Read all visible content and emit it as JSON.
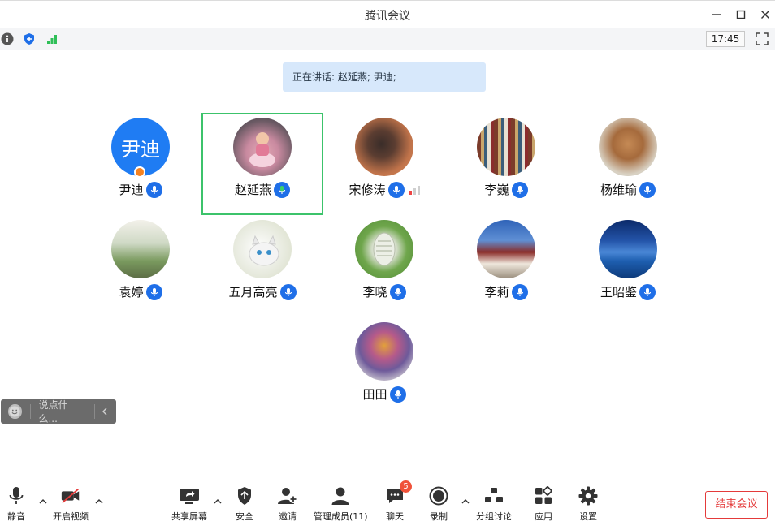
{
  "window": {
    "title": "腾讯会议"
  },
  "toolbar": {
    "clock": "17:45"
  },
  "speaking": {
    "text": "正在讲话: 赵延燕; 尹迪;"
  },
  "avatar_initials": "尹迪",
  "participants": [
    {
      "name": "尹迪",
      "mic": "on",
      "host": true
    },
    {
      "name": "赵延燕",
      "mic": "speaking",
      "active": true
    },
    {
      "name": "宋修涛",
      "mic": "on",
      "signal": "weak"
    },
    {
      "name": "李巍",
      "mic": "on"
    },
    {
      "name": "杨维瑜",
      "mic": "on"
    },
    {
      "name": "袁婷",
      "mic": "on"
    },
    {
      "name": "五月高亮",
      "mic": "on"
    },
    {
      "name": "李晓",
      "mic": "on"
    },
    {
      "name": "李莉",
      "mic": "on"
    },
    {
      "name": "王昭鉴",
      "mic": "on"
    },
    {
      "name": "田田",
      "mic": "on"
    }
  ],
  "chat": {
    "placeholder": "说点什么..."
  },
  "bottombar": {
    "mute": "静音",
    "video": "开启视频",
    "share": "共享屏幕",
    "security": "安全",
    "invite": "邀请",
    "members": "管理成员(11)",
    "chat": "聊天",
    "chat_badge": "5",
    "record": "录制",
    "breakout": "分组讨论",
    "apps": "应用",
    "settings": "设置",
    "end": "结束会议"
  },
  "colors": {
    "accent": "#1f6fe8",
    "active_border": "#3cc36b",
    "end": "#e43a3a",
    "banner": "#d7e8fb"
  }
}
